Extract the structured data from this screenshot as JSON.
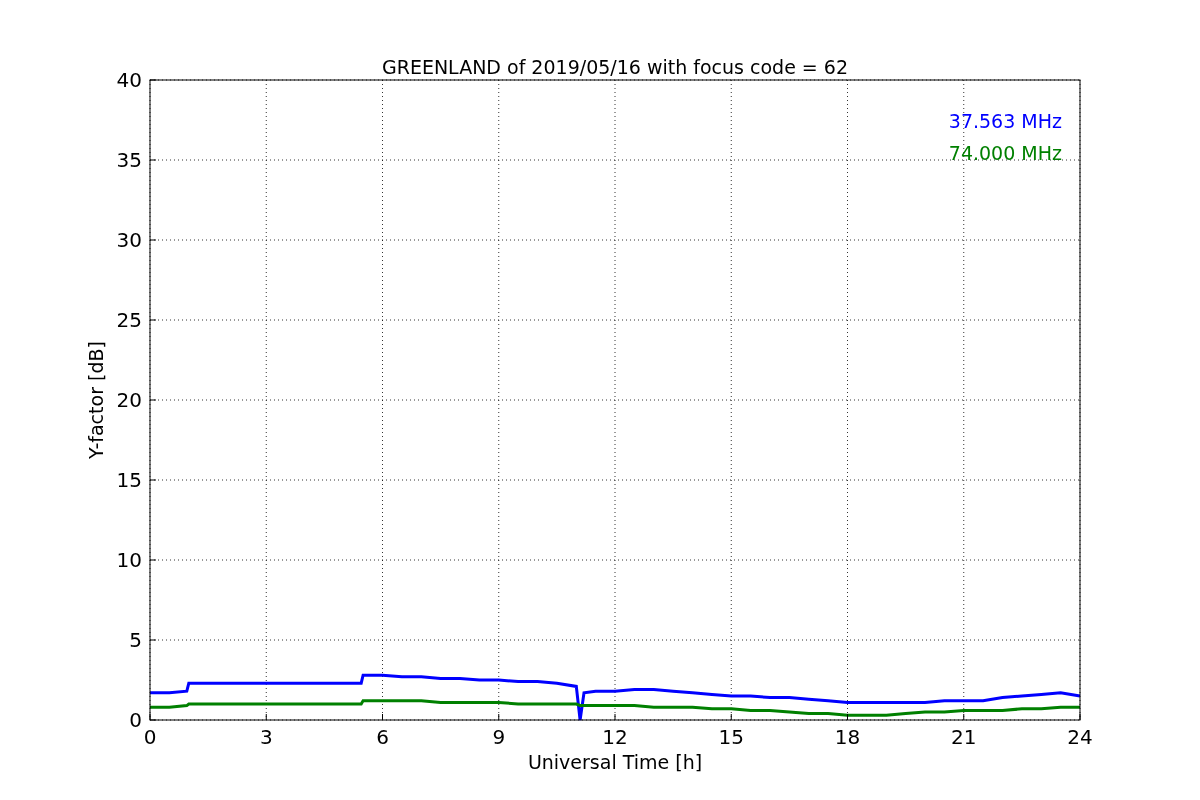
{
  "chart_data": {
    "type": "line",
    "title": "GREENLAND of 2019/05/16 with focus code = 62",
    "xlabel": "Universal Time [h]",
    "ylabel": "Y-factor [dB]",
    "x": [
      0,
      0.5,
      0.95,
      1,
      2,
      3,
      4,
      5,
      5.45,
      5.5,
      6,
      6.5,
      7,
      7.5,
      8,
      8.5,
      9,
      9.5,
      10,
      10.5,
      11,
      11.1,
      11.2,
      11.5,
      12,
      12.5,
      13,
      13.5,
      14,
      14.5,
      15,
      15.5,
      16,
      16.5,
      17,
      17.5,
      18,
      18.5,
      19,
      19.5,
      20,
      20.5,
      21,
      21.5,
      22,
      22.5,
      23,
      23.5,
      24
    ],
    "series": [
      {
        "name": "37.563 MHz",
        "color": "#0000ff",
        "values": [
          1.7,
          1.7,
          1.8,
          2.3,
          2.3,
          2.3,
          2.3,
          2.3,
          2.3,
          2.8,
          2.8,
          2.7,
          2.7,
          2.6,
          2.6,
          2.5,
          2.5,
          2.4,
          2.4,
          2.3,
          2.1,
          0,
          1.7,
          1.8,
          1.8,
          1.9,
          1.9,
          1.8,
          1.7,
          1.6,
          1.5,
          1.5,
          1.4,
          1.4,
          1.3,
          1.2,
          1.1,
          1.1,
          1.1,
          1.1,
          1.1,
          1.2,
          1.2,
          1.2,
          1.4,
          1.5,
          1.6,
          1.7,
          1.5
        ]
      },
      {
        "name": "74.000 MHz",
        "color": "#008000",
        "values": [
          0.8,
          0.8,
          0.9,
          1.0,
          1.0,
          1.0,
          1.0,
          1.0,
          1.0,
          1.2,
          1.2,
          1.2,
          1.2,
          1.1,
          1.1,
          1.1,
          1.1,
          1.0,
          1.0,
          1.0,
          1.0,
          0.9,
          0.9,
          0.9,
          0.9,
          0.9,
          0.8,
          0.8,
          0.8,
          0.7,
          0.7,
          0.6,
          0.6,
          0.5,
          0.4,
          0.4,
          0.3,
          0.3,
          0.3,
          0.4,
          0.5,
          0.5,
          0.6,
          0.6,
          0.6,
          0.7,
          0.7,
          0.8,
          0.8
        ]
      }
    ],
    "grid": true,
    "xlim": [
      0,
      24
    ],
    "ylim": [
      0,
      40
    ],
    "xticks": [
      0,
      3,
      6,
      9,
      12,
      15,
      18,
      21,
      24
    ],
    "yticks": [
      0,
      5,
      10,
      15,
      20,
      25,
      30,
      35,
      40
    ]
  }
}
